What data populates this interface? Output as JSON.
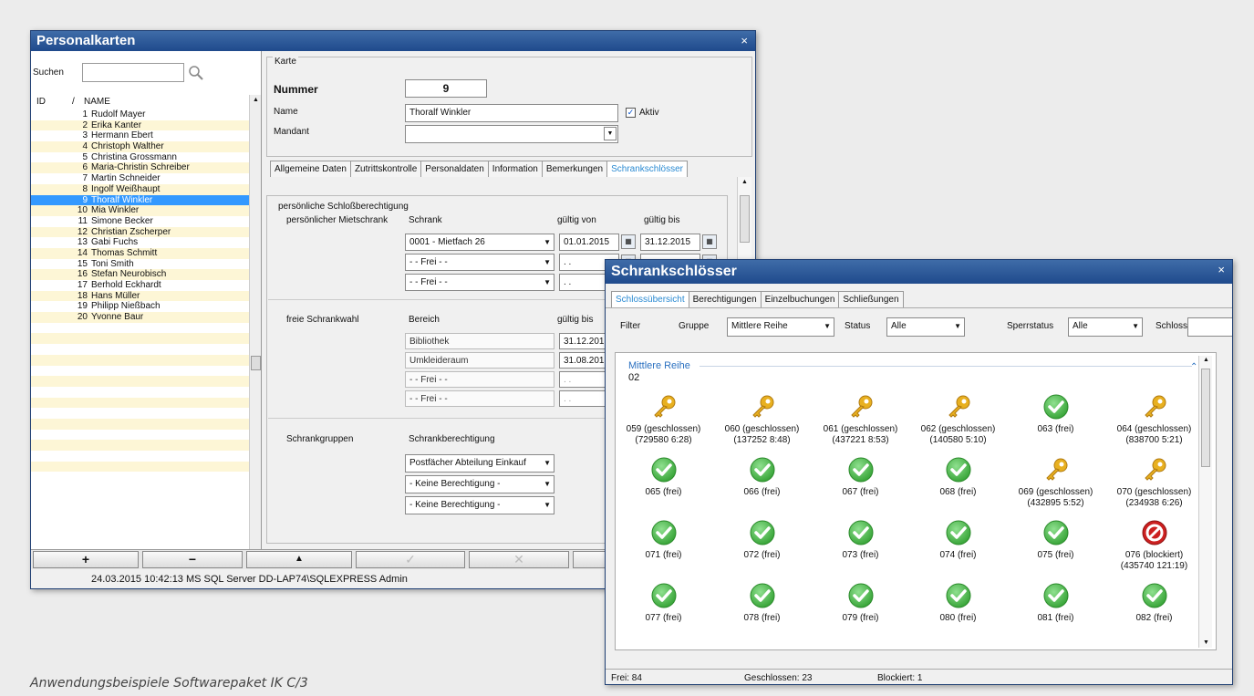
{
  "personalkarten": {
    "title": "Personalkarten",
    "close": "×",
    "search_label": "Suchen",
    "col_id": "ID",
    "col_sort": "/",
    "col_name": "NAME",
    "persons": [
      {
        "id": "1",
        "name": "Rudolf Mayer"
      },
      {
        "id": "2",
        "name": "Erika Kanter"
      },
      {
        "id": "3",
        "name": "Hermann Ebert"
      },
      {
        "id": "4",
        "name": "Christoph Walther"
      },
      {
        "id": "5",
        "name": "Christina Grossmann"
      },
      {
        "id": "6",
        "name": "Maria-Christin Schreiber"
      },
      {
        "id": "7",
        "name": "Martin Schneider"
      },
      {
        "id": "8",
        "name": "Ingolf Weißhaupt"
      },
      {
        "id": "9",
        "name": "Thoralf Winkler"
      },
      {
        "id": "10",
        "name": "Mia Winkler"
      },
      {
        "id": "11",
        "name": "Simone Becker"
      },
      {
        "id": "12",
        "name": "Christian Zscherper"
      },
      {
        "id": "13",
        "name": "Gabi Fuchs"
      },
      {
        "id": "14",
        "name": "Thomas Schmitt"
      },
      {
        "id": "15",
        "name": "Toni Smith"
      },
      {
        "id": "16",
        "name": "Stefan Neurobisch"
      },
      {
        "id": "17",
        "name": "Berhold Eckhardt"
      },
      {
        "id": "18",
        "name": "Hans Müller"
      },
      {
        "id": "19",
        "name": "Philipp Nießbach"
      },
      {
        "id": "20",
        "name": "Yvonne Baur"
      }
    ],
    "selected_id": "9",
    "karte": {
      "group": "Karte",
      "nummer_label": "Nummer",
      "nummer": "9",
      "name_label": "Name",
      "name": "Thoralf Winkler",
      "aktiv_label": "Aktiv",
      "aktiv_checked": true,
      "mandant_label": "Mandant",
      "mandant": ""
    },
    "tabs": [
      "Allgemeine Daten",
      "Zutrittskontrolle",
      "Personaldaten",
      "Information",
      "Bemerkungen",
      "Schrankschlösser"
    ],
    "active_tab": "Schrankschlösser",
    "schloss": {
      "group": "persönliche Schloßberechtigung",
      "mietschrank_label": "persönlicher Mietschrank",
      "col_schrank": "Schrank",
      "col_von": "gültig von",
      "col_bis": "gültig bis",
      "miet_rows": [
        {
          "schrank": "0001 - Mietfach 26",
          "von": "01.01.2015",
          "bis": "31.12.2015"
        },
        {
          "schrank": "- - Frei - -",
          "von": ". .",
          "bis": ""
        },
        {
          "schrank": "- - Frei - -",
          "von": ". .",
          "bis": ""
        }
      ],
      "freie_label": "freie Schrankwahl",
      "col_bereich": "Bereich",
      "col_bis2": "gültig bis",
      "freie_rows": [
        {
          "bereich": "Bibliothek",
          "bis": "31.12.2015"
        },
        {
          "bereich": "Umkleideraum",
          "bis": "31.08.2015"
        },
        {
          "bereich": "- - Frei - -",
          "bis": ". ."
        },
        {
          "bereich": "- - Frei - -",
          "bis": ". ."
        }
      ],
      "gruppen_label": "Schrankgruppen",
      "col_berechtigung": "Schrankberechtigung",
      "gruppen_rows": [
        "Postfächer Abteilung Einkauf",
        "- Keine Berechtigung -",
        "- Keine Berechtigung -"
      ]
    },
    "toolbar": {
      "add": "+",
      "remove": "−",
      "up": "▲",
      "ok": "✓",
      "cancel": "✕"
    },
    "status": "24.03.2015 10:42:13   MS SQL Server DD-LAP74\\SQLEXPRESS   Admin"
  },
  "schrankschloesser": {
    "title": "Schrankschlösser",
    "close": "×",
    "tabs": [
      "Schlossübersicht",
      "Berechtigungen",
      "Einzelbuchungen",
      "Schließungen"
    ],
    "active_tab": "Schlossübersicht",
    "filter": {
      "filter_label": "Filter",
      "gruppe_label": "Gruppe",
      "gruppe_value": "Mittlere Reihe",
      "status_label": "Status",
      "status_value": "Alle",
      "sperr_label": "Sperrstatus",
      "sperr_value": "Alle",
      "schloss_label": "Schloss",
      "schloss_value": ""
    },
    "group_title": "Mittlere Reihe",
    "group_sub": "02",
    "locks": [
      {
        "label": "059 (geschlossen)",
        "detail": "(729580 6:28)",
        "state": "key"
      },
      {
        "label": "060 (geschlossen)",
        "detail": "(137252 8:48)",
        "state": "key"
      },
      {
        "label": "061 (geschlossen)",
        "detail": "(437221 8:53)",
        "state": "key"
      },
      {
        "label": "062 (geschlossen)",
        "detail": "(140580 5:10)",
        "state": "key"
      },
      {
        "label": "063 (frei)",
        "detail": "",
        "state": "free"
      },
      {
        "label": "064 (geschlossen)",
        "detail": "(838700 5:21)",
        "state": "key"
      },
      {
        "label": "065 (frei)",
        "detail": "",
        "state": "free"
      },
      {
        "label": "066 (frei)",
        "detail": "",
        "state": "free"
      },
      {
        "label": "067 (frei)",
        "detail": "",
        "state": "free"
      },
      {
        "label": "068 (frei)",
        "detail": "",
        "state": "free"
      },
      {
        "label": "069 (geschlossen)",
        "detail": "(432895 5:52)",
        "state": "key"
      },
      {
        "label": "070 (geschlossen)",
        "detail": "(234938 6:26)",
        "state": "key"
      },
      {
        "label": "071 (frei)",
        "detail": "",
        "state": "free"
      },
      {
        "label": "072 (frei)",
        "detail": "",
        "state": "free"
      },
      {
        "label": "073 (frei)",
        "detail": "",
        "state": "free"
      },
      {
        "label": "074 (frei)",
        "detail": "",
        "state": "free"
      },
      {
        "label": "075 (frei)",
        "detail": "",
        "state": "free"
      },
      {
        "label": "076 (blockiert)",
        "detail": "(435740 121:19)",
        "state": "blocked"
      },
      {
        "label": "077 (frei)",
        "detail": "",
        "state": "free"
      },
      {
        "label": "078 (frei)",
        "detail": "",
        "state": "free"
      },
      {
        "label": "079 (frei)",
        "detail": "",
        "state": "free"
      },
      {
        "label": "080 (frei)",
        "detail": "",
        "state": "free"
      },
      {
        "label": "081 (frei)",
        "detail": "",
        "state": "free"
      },
      {
        "label": "082 (frei)",
        "detail": "",
        "state": "free"
      }
    ],
    "status": {
      "frei": "Frei: 84",
      "geschlossen": "Geschlossen: 23",
      "blockiert": "Blockiert: 1"
    }
  },
  "caption": "Anwendungsbeispiele Softwarepaket IK C/3",
  "colors": {
    "title": "#1f4a8c",
    "selection": "#3399ff",
    "tab_active": "#2a8ad2",
    "free": "#3aa63a",
    "key": "#e8b020",
    "blocked": "#cc2020"
  }
}
